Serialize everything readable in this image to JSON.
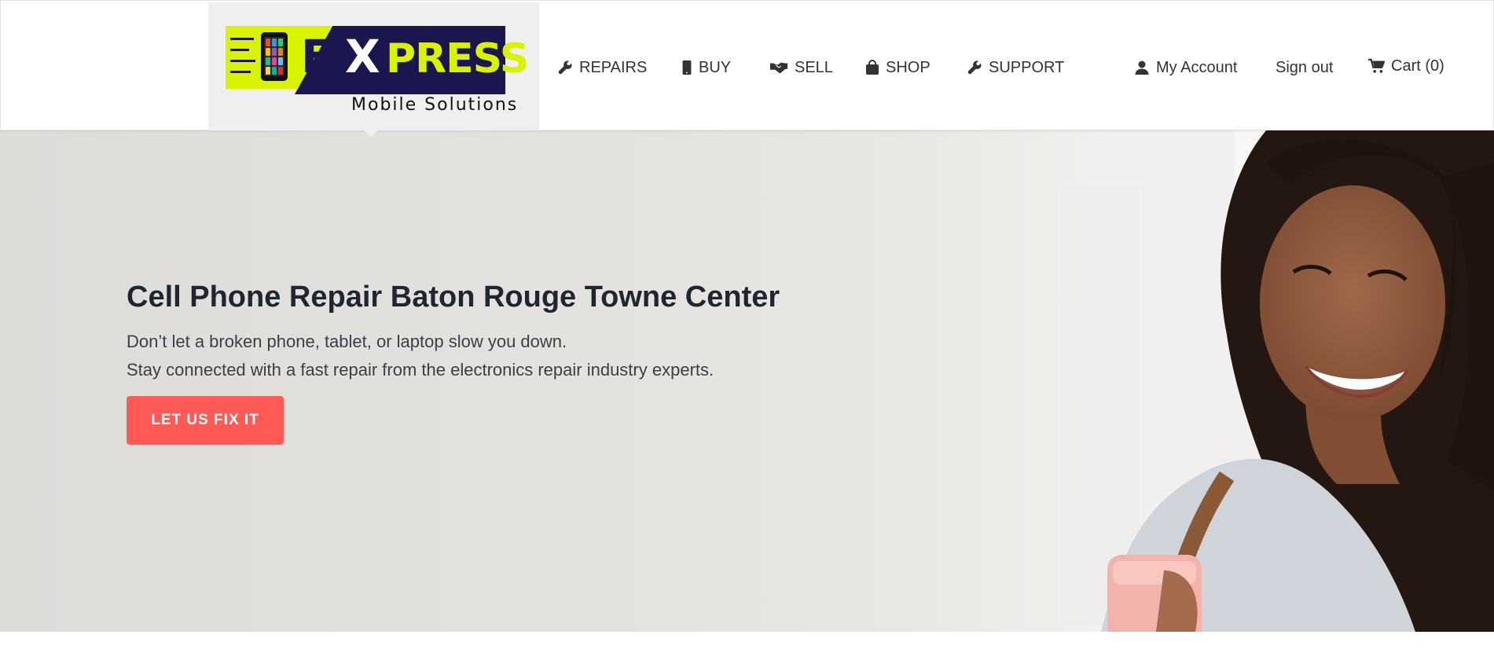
{
  "brand": {
    "logo_text_e": "E",
    "logo_text_x": "X",
    "logo_text_press": "PRESS",
    "logo_subtitle": "Mobile Solutions",
    "colors": {
      "lime": "#d9f200",
      "navy": "#1a1650"
    }
  },
  "nav": {
    "items": [
      {
        "label": "REPAIRS",
        "icon": "wrench-icon"
      },
      {
        "label": "BUY",
        "icon": "phone-icon"
      },
      {
        "label": "SELL",
        "icon": "handshake-icon"
      },
      {
        "label": "SHOP",
        "icon": "shopping-bag-icon"
      },
      {
        "label": "SUPPORT",
        "icon": "wrench-icon"
      }
    ],
    "account": {
      "label": "My Account",
      "icon": "user-icon"
    },
    "signout": {
      "label": "Sign out"
    },
    "cart": {
      "label": "Cart (0)",
      "icon": "cart-icon"
    }
  },
  "hero": {
    "title": "Cell Phone Repair Baton Rouge Towne Center",
    "line1": "Don’t let a broken phone, tablet, or laptop slow you down.",
    "line2": "Stay connected with a fast repair from the electronics repair industry experts.",
    "cta": "LET US FIX IT",
    "cta_color": "#ff5a55",
    "photo": "smiling-woman-holding-phone"
  }
}
